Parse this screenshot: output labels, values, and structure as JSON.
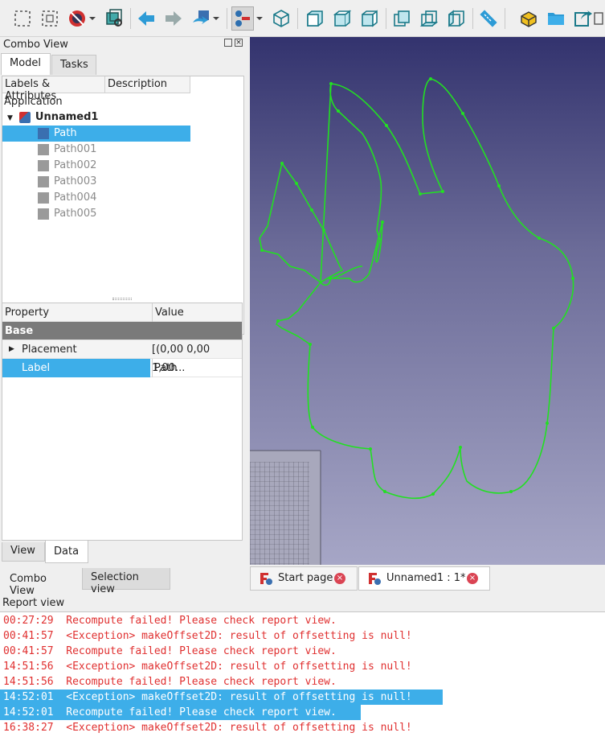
{
  "toolbar": {
    "icons": [
      "box-select-icon",
      "box-element-select-icon",
      "draw-style-icon",
      "bounding-box-icon",
      "back-icon",
      "forward-icon",
      "macro-run-icon",
      "std-view-menu-icon",
      "isometric-view-icon",
      "front-view-icon",
      "top-view-icon",
      "right-view-icon",
      "rear-view-icon",
      "bottom-view-icon",
      "left-view-icon",
      "measure-icon",
      "part-icon",
      "folder-icon",
      "export-icon"
    ]
  },
  "combo_view": {
    "title": "Combo View",
    "tabs": [
      "Model",
      "Tasks"
    ],
    "tree_headers": [
      "Labels & Attributes",
      "Description"
    ],
    "application_label": "Application",
    "document": "Unnamed1",
    "items": [
      "Path",
      "Path001",
      "Path002",
      "Path003",
      "Path004",
      "Path005"
    ],
    "selected_index": 0,
    "property_headers": [
      "Property",
      "Value"
    ],
    "group": "Base",
    "properties": [
      {
        "name": "Placement",
        "value": "[(0,00 0,00 1,00..."
      },
      {
        "name": "Label",
        "value": "Path"
      }
    ],
    "bottom_tabs": [
      "View",
      "Data"
    ]
  },
  "dock_tabs": [
    "Combo View",
    "Selection view"
  ],
  "doc_tabs": [
    {
      "label": "Start page",
      "active": false
    },
    {
      "label": "Unnamed1 : 1*",
      "active": true
    }
  ],
  "report": {
    "title": "Report view",
    "lines": [
      {
        "text": "00:27:29  Recompute failed! Please check report view.",
        "highlight": false
      },
      {
        "text": "00:41:57  <Exception> makeOffset2D: result of offsetting is null!",
        "highlight": false
      },
      {
        "text": "00:41:57  Recompute failed! Please check report view.",
        "highlight": false
      },
      {
        "text": "14:51:56  <Exception> makeOffset2D: result of offsetting is null!",
        "highlight": false
      },
      {
        "text": "14:51:56  Recompute failed! Please check report view.",
        "highlight": false
      },
      {
        "text": "14:52:01  <Exception> makeOffset2D: result of offsetting is null!",
        "highlight": true
      },
      {
        "text": "14:52:01  Recompute failed! Please check report view.",
        "highlight": true
      },
      {
        "text": "16:38:27  <Exception> makeOffset2D: result of offsetting is null!",
        "highlight": false
      }
    ]
  },
  "colors": {
    "accent": "#3daee9",
    "path": "#22e022",
    "error": "#e03030"
  }
}
